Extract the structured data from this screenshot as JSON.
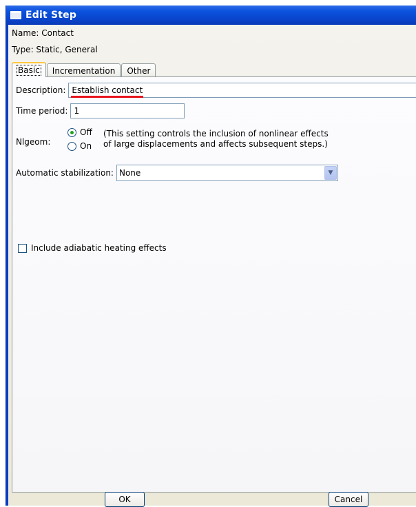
{
  "window": {
    "title": "Edit Step"
  },
  "info": {
    "name_text": "Name:  Contact",
    "type_text": "Type:  Static, General"
  },
  "tabs": [
    {
      "label": "Basic",
      "active": true
    },
    {
      "label": "Incrementation",
      "active": false
    },
    {
      "label": "Other",
      "active": false
    }
  ],
  "basic": {
    "description_label": "Description:",
    "description_value": "Establish contact",
    "time_period_label": "Time period:",
    "time_period_value": "1",
    "nlgeom_label": "Nlgeom:",
    "nlgeom_options": [
      "Off",
      "On"
    ],
    "nlgeom_selected": "Off",
    "nlgeom_note_line1": "(This setting controls the inclusion of nonlinear effects",
    "nlgeom_note_line2": "of large displacements and affects subsequent steps.)",
    "stabilization_label": "Automatic stabilization:",
    "stabilization_value": "None",
    "adiabatic_label": "Include adiabatic heating effects",
    "adiabatic_checked": false
  },
  "buttons": {
    "ok": "OK",
    "cancel": "Cancel"
  },
  "colors": {
    "title_bar": "#0a52de",
    "annotation_underline": "#e8161d",
    "active_tab_highlight": "#ffc83c"
  }
}
